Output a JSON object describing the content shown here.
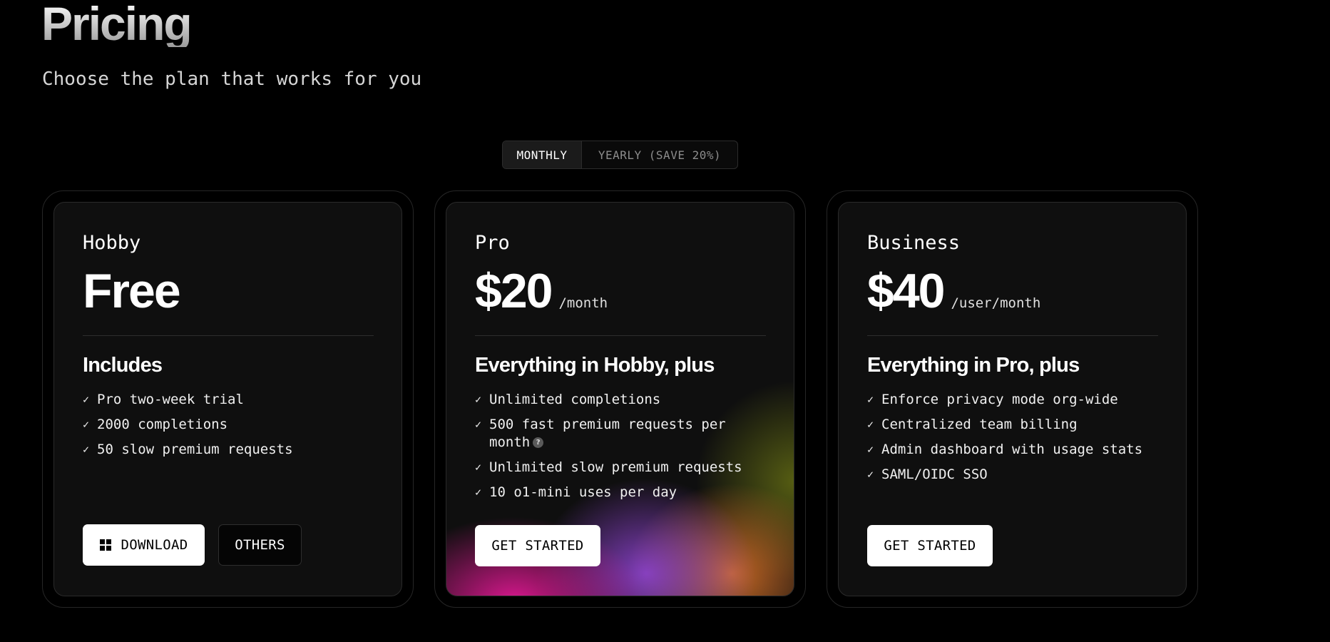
{
  "header": {
    "title": "Pricing",
    "subtitle": "Choose the plan that works for you"
  },
  "billing_toggle": {
    "monthly": "MONTHLY",
    "yearly": "YEARLY (SAVE 20%)",
    "selected": "MONTHLY"
  },
  "plans": [
    {
      "name": "Hobby",
      "price": "Free",
      "unit": "",
      "includes": "Includes",
      "features": [
        "Pro two-week trial",
        "2000 completions",
        "50 slow premium requests"
      ],
      "buttons": [
        "DOWNLOAD",
        "OTHERS"
      ]
    },
    {
      "name": "Pro",
      "price": "$20",
      "unit": "/month",
      "includes": "Everything in Hobby, plus",
      "features": [
        "Unlimited completions",
        "500 fast premium requests per month",
        "Unlimited slow premium requests",
        "10 o1-mini uses per day"
      ],
      "help_icon": "?",
      "buttons": [
        "GET STARTED"
      ]
    },
    {
      "name": "Business",
      "price": "$40",
      "unit": "/user/month",
      "includes": "Everything in Pro, plus",
      "features": [
        "Enforce privacy mode org-wide",
        "Centralized team billing",
        "Admin dashboard with usage stats",
        "SAML/OIDC SSO"
      ],
      "buttons": [
        "GET STARTED"
      ]
    }
  ],
  "icons": {
    "check": "✓",
    "download": "windows-icon"
  },
  "colors": {
    "background": "#000000",
    "card": "#0f0f0f",
    "button": "#ffffff",
    "pro_gradient": [
      "#e21894",
      "#9646dc",
      "#e67828",
      "#6e7814"
    ]
  }
}
